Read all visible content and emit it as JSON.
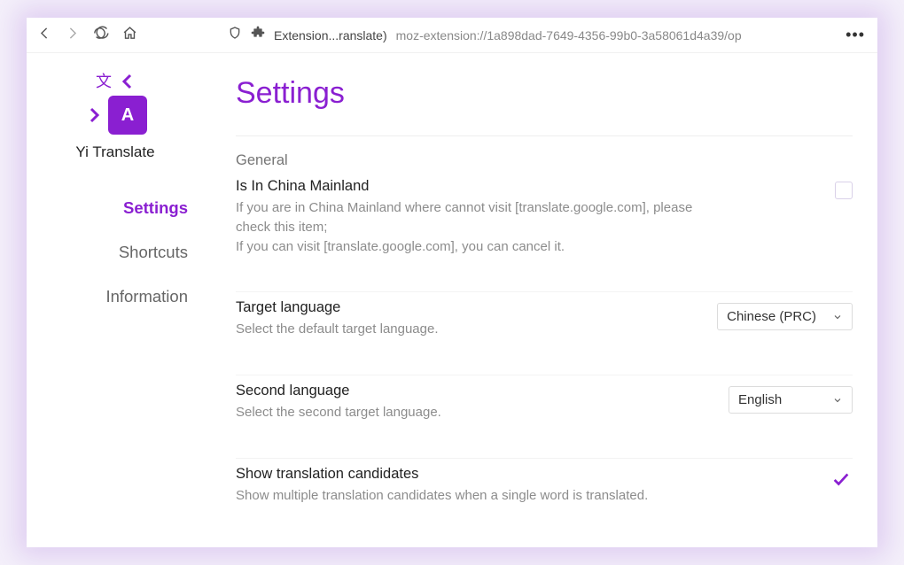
{
  "browser": {
    "page_label": "Extension...ranslate)",
    "url": "moz-extension://1a898dad-7649-4356-99b0-3a58061d4a39/op",
    "more": "•••"
  },
  "sidebar": {
    "app_name": "Yi Translate",
    "items": [
      {
        "label": "Settings",
        "active": true
      },
      {
        "label": "Shortcuts",
        "active": false
      },
      {
        "label": "Information",
        "active": false
      }
    ]
  },
  "page": {
    "title": "Settings",
    "section": "General",
    "settings": [
      {
        "label": "Is In China Mainland",
        "desc": "If you are in China Mainland where cannot visit [translate.google.com], please check this item;\nIf you can visit [translate.google.com], you can cancel it.",
        "control": "checkbox",
        "checked": false
      },
      {
        "label": "Target language",
        "desc": "Select the default target language.",
        "control": "select",
        "value": "Chinese (PRC)"
      },
      {
        "label": "Second language",
        "desc": "Select the second target language.",
        "control": "select",
        "value": "English"
      },
      {
        "label": "Show translation candidates",
        "desc": "Show multiple translation candidates when a single word is translated.",
        "control": "checkbox",
        "checked": true
      }
    ]
  }
}
